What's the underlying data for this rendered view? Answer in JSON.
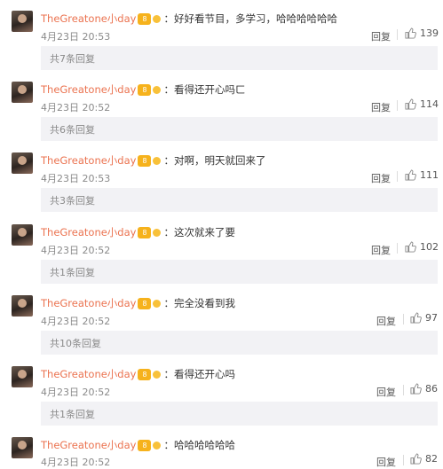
{
  "comments": [
    {
      "user": "TheGreatone小day",
      "badge": "8",
      "text": "：好好看节目，多学习，哈哈哈哈哈哈",
      "time": "4月23日 20:53",
      "reply_label": "回复",
      "likes": "139",
      "replies_summary": "共7条回复"
    },
    {
      "user": "TheGreatone小day",
      "badge": "8",
      "text": "：看得还开心吗ㄈ",
      "time": "4月23日 20:52",
      "reply_label": "回复",
      "likes": "114",
      "replies_summary": "共6条回复"
    },
    {
      "user": "TheGreatone小day",
      "badge": "8",
      "text": "：对啊，明天就回来了",
      "time": "4月23日 20:53",
      "reply_label": "回复",
      "likes": "111",
      "replies_summary": "共3条回复"
    },
    {
      "user": "TheGreatone小day",
      "badge": "8",
      "text": "：这次就来了要",
      "time": "4月23日 20:52",
      "reply_label": "回复",
      "likes": "102",
      "replies_summary": "共1条回复"
    },
    {
      "user": "TheGreatone小day",
      "badge": "8",
      "text": "：完全没看到我",
      "time": "4月23日 20:52",
      "reply_label": "回复",
      "likes": "97",
      "replies_summary": "共10条回复"
    },
    {
      "user": "TheGreatone小day",
      "badge": "8",
      "text": "：看得还开心吗",
      "time": "4月23日 20:52",
      "reply_label": "回复",
      "likes": "86",
      "replies_summary": "共1条回复"
    },
    {
      "user": "TheGreatone小day",
      "badge": "8",
      "text": "：哈哈哈哈哈哈",
      "time": "4月23日 20:52",
      "reply_label": "回复",
      "likes": "82",
      "replies_summary": ""
    }
  ],
  "icons": {
    "like": "thumbs-up-icon",
    "badge": "vip-badge-icon",
    "crown": "crown-icon"
  },
  "colors": {
    "username": "#eb7350",
    "badge": "#f6b21c",
    "reply_bar": "#f2f2f5"
  }
}
